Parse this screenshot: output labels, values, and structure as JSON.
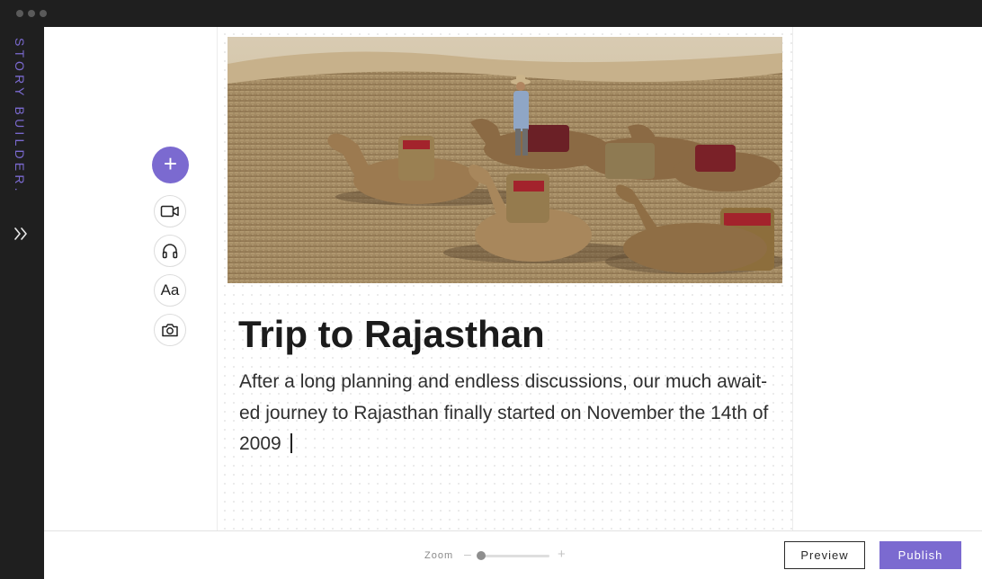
{
  "window": {
    "controls": [
      "close",
      "minimize",
      "maximize"
    ]
  },
  "sidebar": {
    "brand": "STORY BUILDER.",
    "expand_icon": "chevrons-right-icon"
  },
  "toolbar": {
    "add_label": "+",
    "tools": [
      {
        "name": "video",
        "icon": "video-camera-icon"
      },
      {
        "name": "audio",
        "icon": "headphones-icon"
      },
      {
        "name": "text",
        "label": "Aa"
      },
      {
        "name": "photo",
        "icon": "camera-icon"
      }
    ]
  },
  "story": {
    "image_alt": "Camels resting on desert sand with a man in a hat",
    "title": "Trip to Rajasthan",
    "body": "After a long planning and endless discussions, our much await-ed journey to Rajasthan finally started on November the 14th of 2009"
  },
  "footer": {
    "zoom_label": "Zoom",
    "zoom_minus": "–",
    "zoom_plus": "+",
    "zoom_level": 0.05,
    "preview_label": "Preview",
    "publish_label": "Publish"
  },
  "colors": {
    "accent": "#7b6ad0",
    "chrome": "#1f1f1f",
    "text": "#1b1b1b"
  }
}
